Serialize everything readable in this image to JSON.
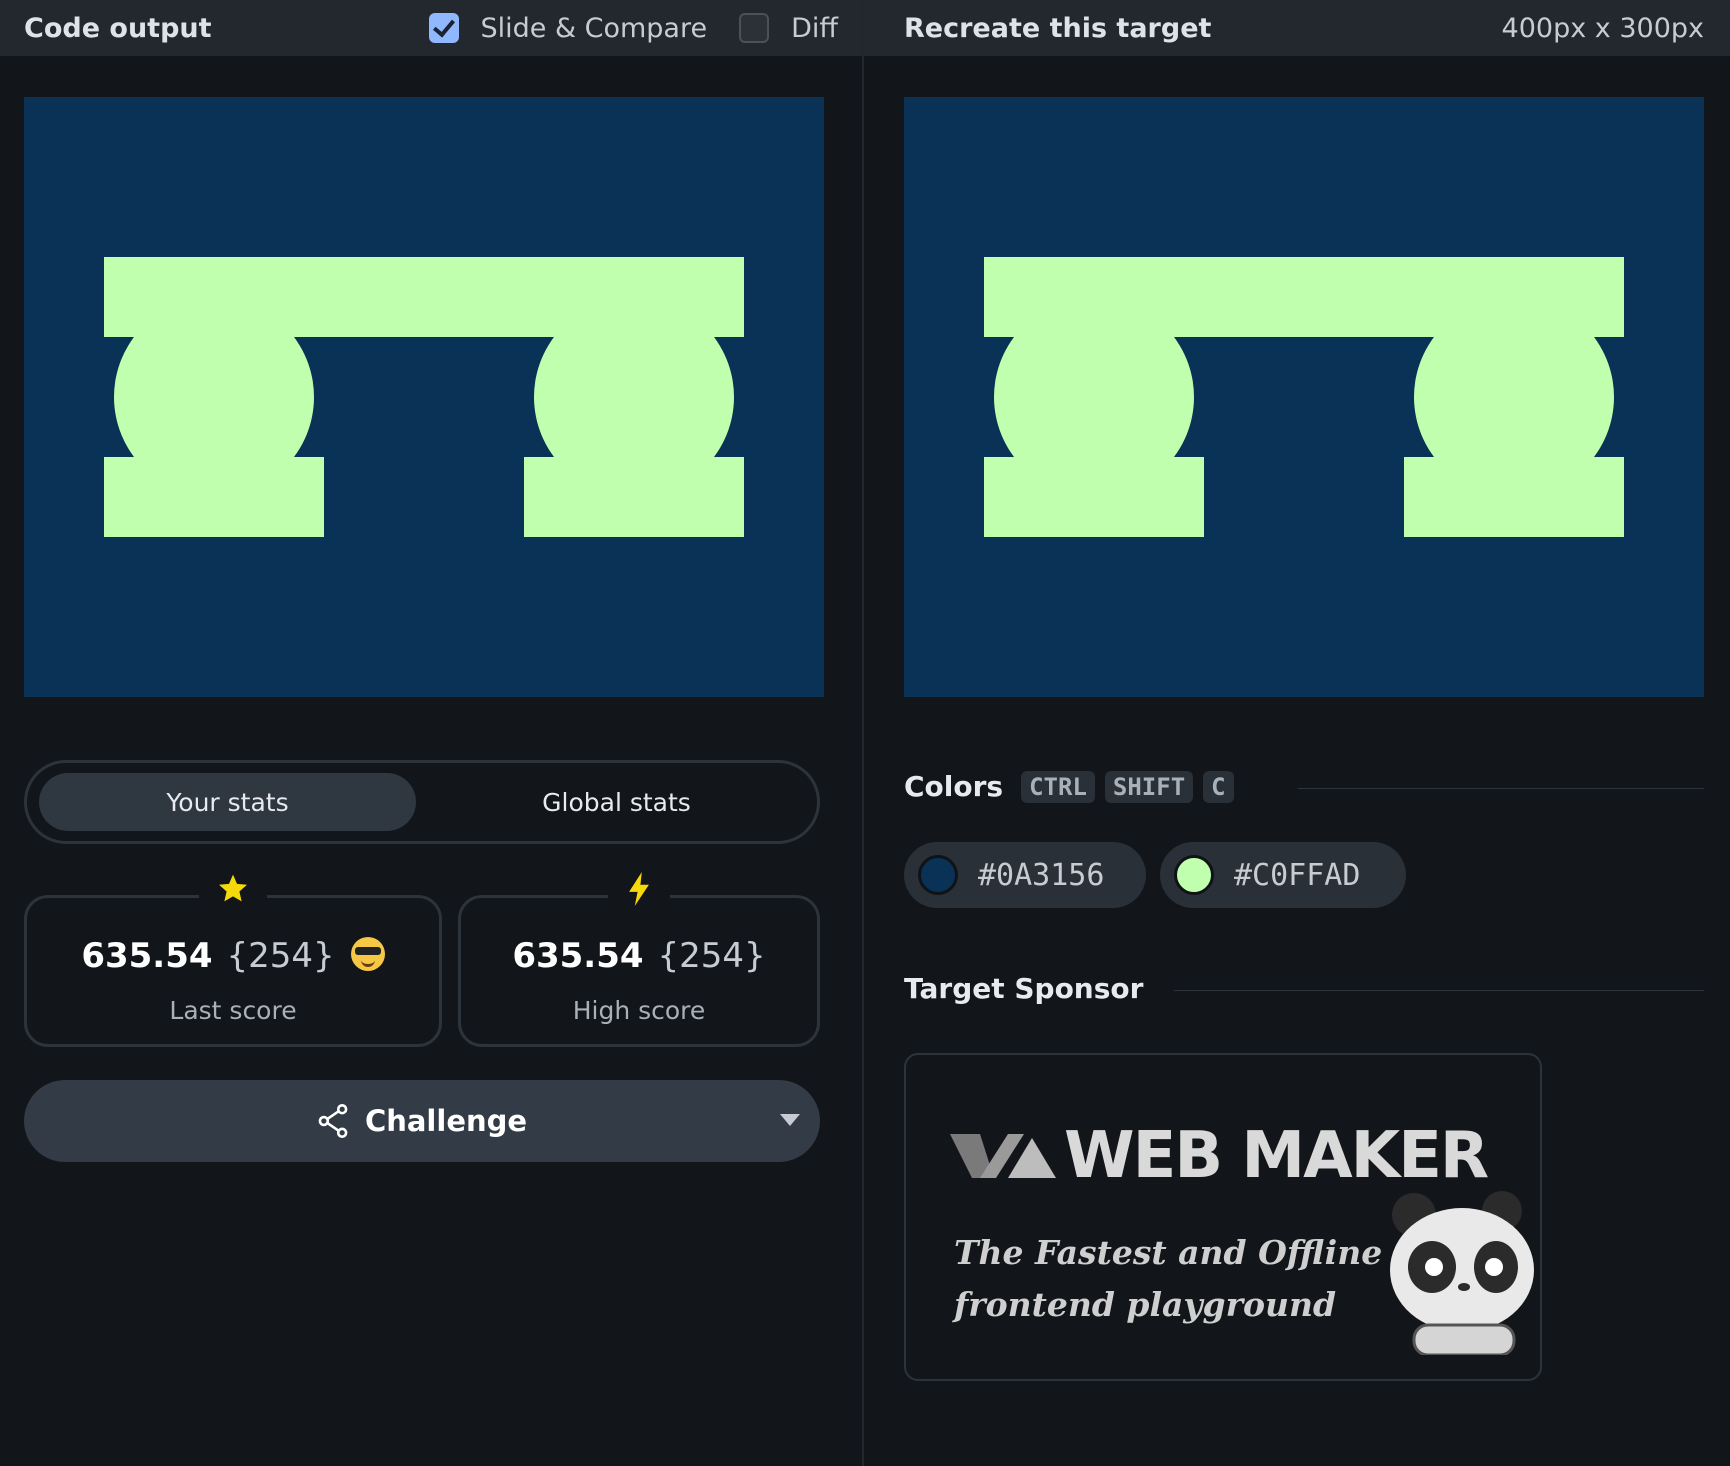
{
  "left_header": {
    "title": "Code output",
    "slide_compare_label": "Slide & Compare",
    "slide_compare_checked": true,
    "diff_label": "Diff",
    "diff_checked": false
  },
  "right_header": {
    "title": "Recreate this target",
    "dimensions": "400px x 300px"
  },
  "stats_tabs": [
    {
      "label": "Your stats",
      "active": true
    },
    {
      "label": "Global stats",
      "active": false
    }
  ],
  "last_score": {
    "value": "635.54",
    "count": "{254}",
    "label": "Last score",
    "badge": "star-icon"
  },
  "high_score": {
    "value": "635.54",
    "count": "{254}",
    "label": "High score",
    "badge": "lightning-icon"
  },
  "challenge": {
    "label": "Challenge"
  },
  "colors_section": {
    "title": "Colors",
    "shortcut": [
      "CTRL",
      "SHIFT",
      "C"
    ],
    "swatches": [
      {
        "hex": "#0A3156",
        "color": "#0A3156"
      },
      {
        "hex": "#C0FFAD",
        "color": "#C0FFAD"
      }
    ]
  },
  "sponsor_section": {
    "title": "Target Sponsor",
    "brand": "WEB MAKER",
    "tagline_1": "The Fastest and Offline",
    "tagline_2": "frontend playground"
  },
  "target_colors": {
    "background": "#0A3156",
    "foreground": "#C0FFAD"
  }
}
